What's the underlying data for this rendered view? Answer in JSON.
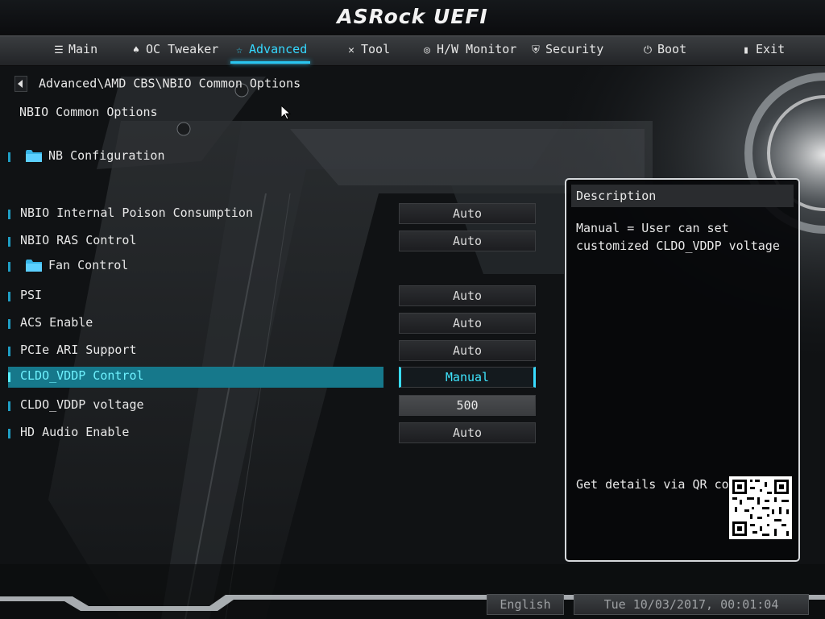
{
  "header": {
    "brand": "ASRock",
    "product": "UEFI"
  },
  "nav": {
    "tabs": [
      {
        "label": "Main",
        "icon": "list-icon"
      },
      {
        "label": "OC Tweaker",
        "icon": "rocket-icon"
      },
      {
        "label": "Advanced",
        "icon": "star-icon",
        "active": true
      },
      {
        "label": "Tool",
        "icon": "tools-icon"
      },
      {
        "label": "H/W Monitor",
        "icon": "monitor-icon"
      },
      {
        "label": "Security",
        "icon": "shield-icon"
      },
      {
        "label": "Boot",
        "icon": "power-icon"
      },
      {
        "label": "Exit",
        "icon": "exit-icon"
      }
    ]
  },
  "breadcrumb": {
    "path": "Advanced\\AMD CBS\\NBIO Common Options"
  },
  "page": {
    "title": "NBIO Common Options"
  },
  "settings": [
    {
      "label": "NB Configuration",
      "type": "folder"
    },
    {
      "label": "NBIO Internal Poison Consumption",
      "value": "Auto"
    },
    {
      "label": "NBIO RAS Control",
      "value": "Auto"
    },
    {
      "label": "Fan Control",
      "type": "folder"
    },
    {
      "label": "PSI",
      "value": "Auto"
    },
    {
      "label": "ACS Enable",
      "value": "Auto"
    },
    {
      "label": "PCIe ARI Support",
      "value": "Auto"
    },
    {
      "label": "CLDO_VDDP Control",
      "value": "Manual",
      "selected": true
    },
    {
      "label": "CLDO_VDDP voltage",
      "value": "500"
    },
    {
      "label": "HD Audio Enable",
      "value": "Auto"
    }
  ],
  "description": {
    "heading": "Description",
    "text": "Manual = User can set customized CLDO_VDDP voltage",
    "qr_label": "Get details via QR code"
  },
  "footer": {
    "language": "English",
    "datetime": "Tue 10/03/2017, 00:01:04"
  },
  "colors": {
    "accent": "#35d8ff",
    "selected_row": "#16788b",
    "marker": "#1f9ec4"
  }
}
